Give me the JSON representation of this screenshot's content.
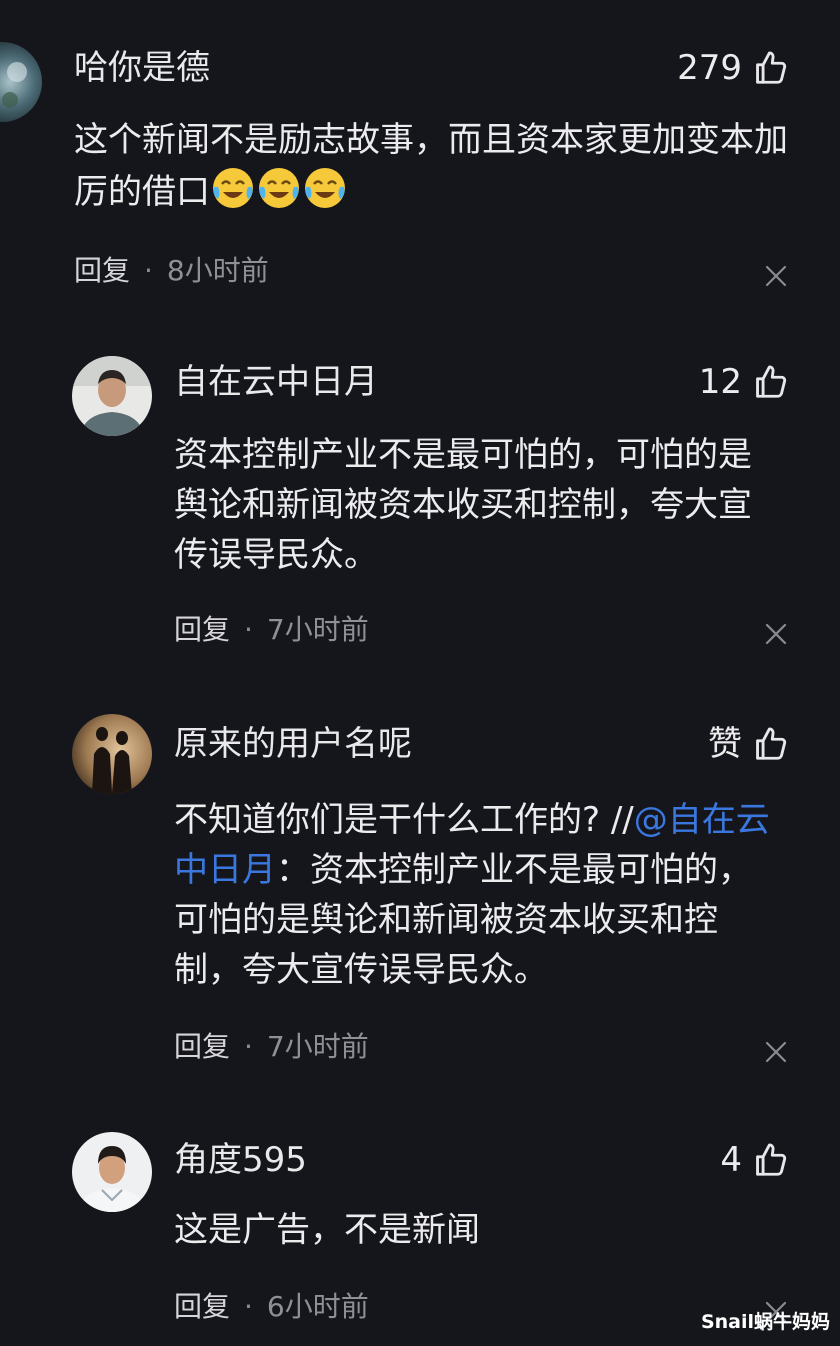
{
  "comments": [
    {
      "user": "哈你是德",
      "likes": "279",
      "text": "这个新闻不是励志故事，而且资本家更加变本加厉的借口",
      "emoji_name": "crying-laughing-emoji",
      "reply_label": "回复",
      "separator": "·",
      "time": "8小时前"
    },
    {
      "user": "自在云中日月",
      "likes": "12",
      "text": "资本控制产业不是最可怕的，可怕的是舆论和新闻被资本收买和控制，夸大宣传误导民众。",
      "reply_label": "回复",
      "separator": "·",
      "time": "7小时前"
    },
    {
      "user": "原来的用户名呢",
      "likes": "赞",
      "text_prefix": "不知道你们是干什么工作的? //",
      "mention": "@自在云中日月",
      "text_suffix": "：资本控制产业不是最可怕的，可怕的是舆论和新闻被资本收买和控制，夸大宣传误导民众。",
      "reply_label": "回复",
      "separator": "·",
      "time": "7小时前"
    },
    {
      "user": "角度595",
      "likes": "4",
      "text": "这是广告，不是新闻",
      "reply_label": "回复",
      "separator": "·",
      "time": "6小时前"
    }
  ],
  "watermark": "Snail蜗牛妈妈",
  "colors": {
    "background": "#15161b",
    "text": "#ececef",
    "secondary": "#8f9097",
    "mention": "#3a78e0"
  }
}
